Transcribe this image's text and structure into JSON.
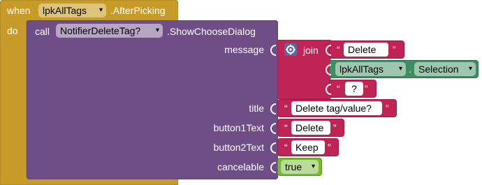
{
  "event_block": {
    "when_label": "when",
    "component": "lpkAllTags",
    "event_name": ".AfterPicking",
    "do_label": "do"
  },
  "call_block": {
    "call_label": "call",
    "component": "NotifierDeleteTag?",
    "method": ".ShowChooseDialog",
    "params": {
      "message": "message",
      "title": "title",
      "button1": "button1Text",
      "button2": "button2Text",
      "cancelable": "cancelable"
    }
  },
  "join_block": {
    "label": "join",
    "text1": "Delete",
    "text3": "?"
  },
  "selection_block": {
    "component": "lpkAllTags",
    "dot": ".",
    "property": "Selection"
  },
  "title_text": "Delete tag/value?",
  "button1_text": "Delete",
  "button2_text": "Keep",
  "cancelable_value": "true",
  "quote_open": "“",
  "quote_close": "”",
  "dropdown_arrow": "▾",
  "icons": {
    "mutator": "gear-icon"
  },
  "colors": {
    "event": "#c69b28",
    "call": "#6f4d87",
    "text": "#c02454",
    "component_getter": "#3d8f63",
    "logic": "#76ba32"
  }
}
